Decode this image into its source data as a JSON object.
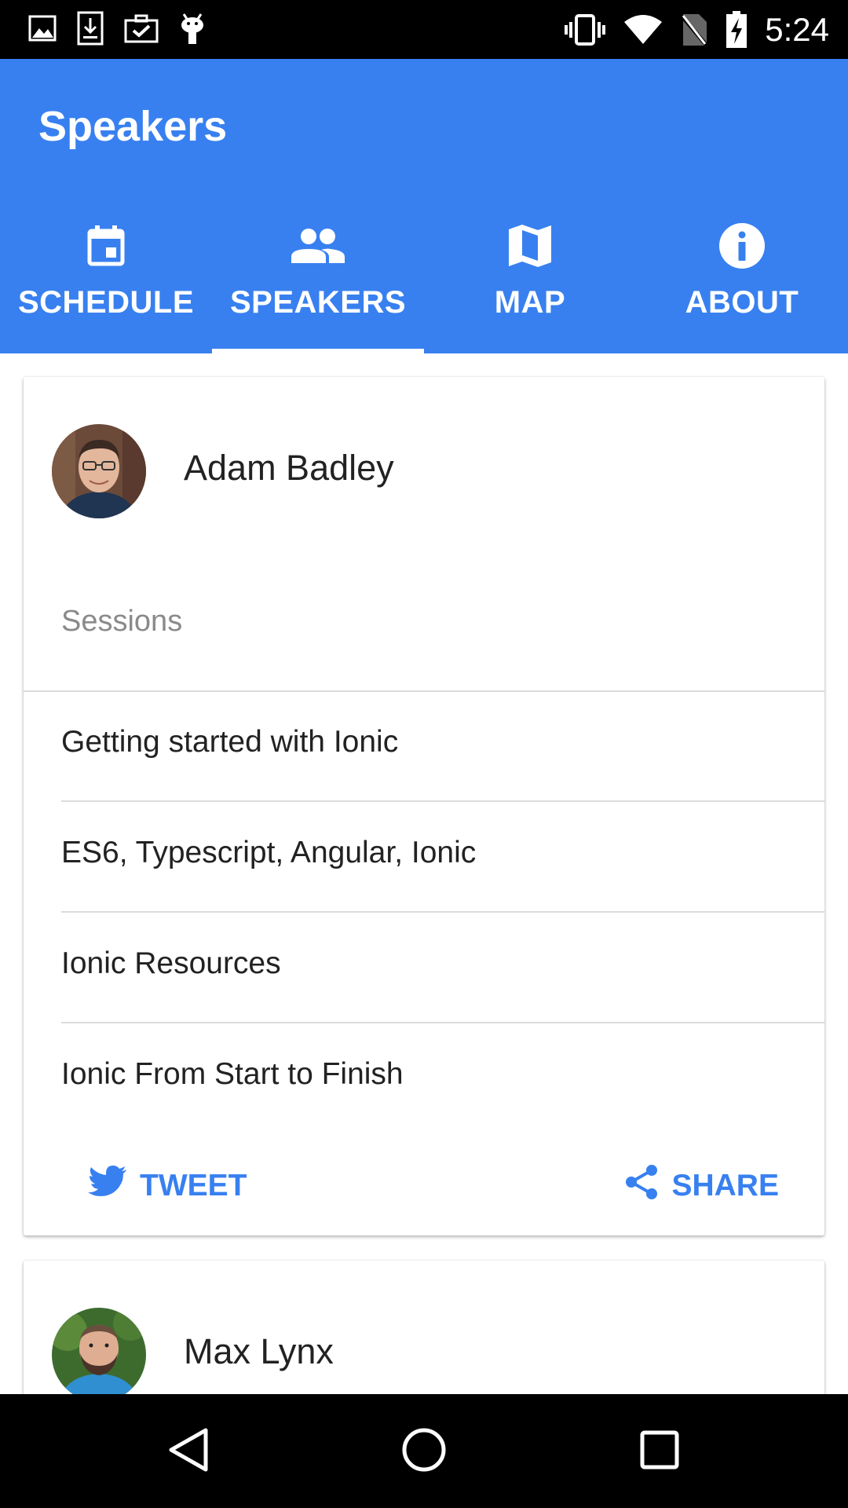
{
  "status_bar": {
    "time": "5:24",
    "left_icons": [
      "image-icon",
      "download-icon",
      "briefcase-check-icon",
      "android-icon"
    ],
    "right_icons": [
      "vibrate-icon",
      "wifi-icon",
      "no-sim-icon",
      "battery-charging-icon"
    ]
  },
  "toolbar": {
    "title": "Speakers"
  },
  "tabs": [
    {
      "label": "SCHEDULE",
      "icon": "calendar-icon",
      "selected": false
    },
    {
      "label": "SPEAKERS",
      "icon": "people-icon",
      "selected": true
    },
    {
      "label": "MAP",
      "icon": "map-icon",
      "selected": false
    },
    {
      "label": "ABOUT",
      "icon": "info-icon",
      "selected": false
    }
  ],
  "speakers": [
    {
      "name": "Adam Badley",
      "sessions_label": "Sessions",
      "sessions": [
        "Getting started with Ionic",
        "ES6, Typescript, Angular, Ionic",
        "Ionic Resources",
        "Ionic From Start to Finish"
      ],
      "actions": {
        "tweet": "TWEET",
        "share": "SHARE"
      }
    },
    {
      "name": "Max Lynx"
    }
  ],
  "nav_bar": [
    "back-icon",
    "home-icon",
    "recents-icon"
  ],
  "colors": {
    "primary": "#3880f0",
    "status_bar": "#000000",
    "text": "#222222",
    "muted": "#8a8a8a"
  }
}
